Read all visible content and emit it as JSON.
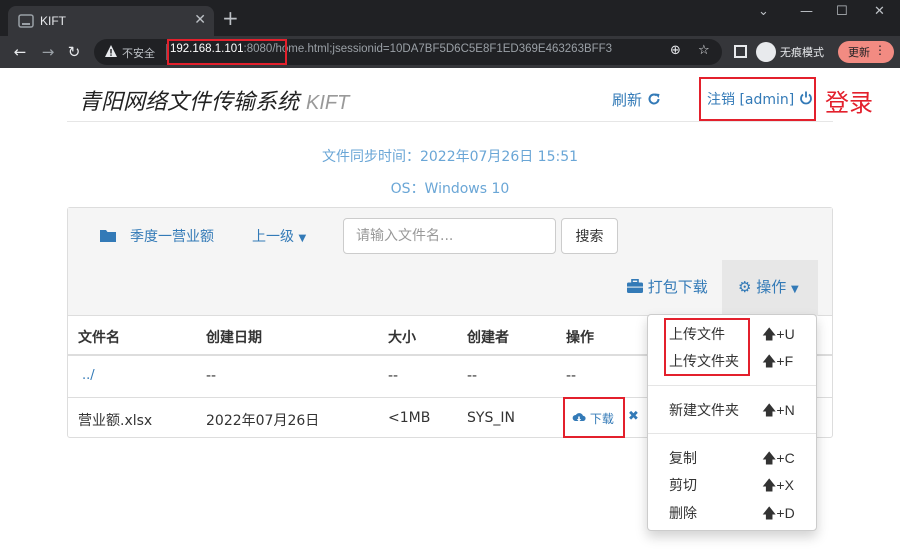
{
  "browser": {
    "tab_title": "KIFT",
    "tab_close": "✕",
    "new_tab": "+",
    "insecure_label": "不安全",
    "url_host": "192.168.1.101",
    "url_rest": ":8080/home.html;jsessionid=10DA7BF5D6C5E8F1ED369E463263BFF3",
    "incognito_label": "无痕模式",
    "update_label": "更新",
    "update_menu": "⋮"
  },
  "header": {
    "brand": "青阳网络文件传输系统",
    "brand_sub": "KIFT",
    "refresh_label": "刷新",
    "logout_label": "注销 [admin]",
    "annotation_login": "登录"
  },
  "sync": {
    "time_line": "文件同步时间：2022年07月26日 15:51",
    "os_line": "OS：Windows 10"
  },
  "nav": {
    "folder_name": "季度一营业额",
    "parent_label": "上一级",
    "search_placeholder": "请输入文件名...",
    "search_button": "搜索",
    "pack_download": "打包下载",
    "operations": "操作"
  },
  "table": {
    "headers": [
      "文件名",
      "创建日期",
      "大小",
      "创建者",
      "操作"
    ],
    "rows": [
      {
        "name": "../",
        "date": "--",
        "size": "--",
        "creator": "--",
        "ops": "--"
      },
      {
        "name": "营业额.xlsx",
        "date": "2022年07月26日",
        "size": "<1MB",
        "creator": "SYS_IN",
        "download": "下载",
        "delete": "✖"
      }
    ]
  },
  "dropdown": {
    "items": [
      {
        "label": "上传文件",
        "shortcut": "+U"
      },
      {
        "label": "上传文件夹",
        "shortcut": "+F"
      },
      {
        "label": "新建文件夹",
        "shortcut": "+N"
      },
      {
        "label": "复制",
        "shortcut": "+C"
      },
      {
        "label": "剪切",
        "shortcut": "+X"
      },
      {
        "label": "删除",
        "shortcut": "+D"
      }
    ]
  },
  "colors": {
    "link": "#337ab7",
    "annotation_red": "#e3202c",
    "sync_text": "#6aa6d6",
    "chrome_dark": "#202124"
  }
}
